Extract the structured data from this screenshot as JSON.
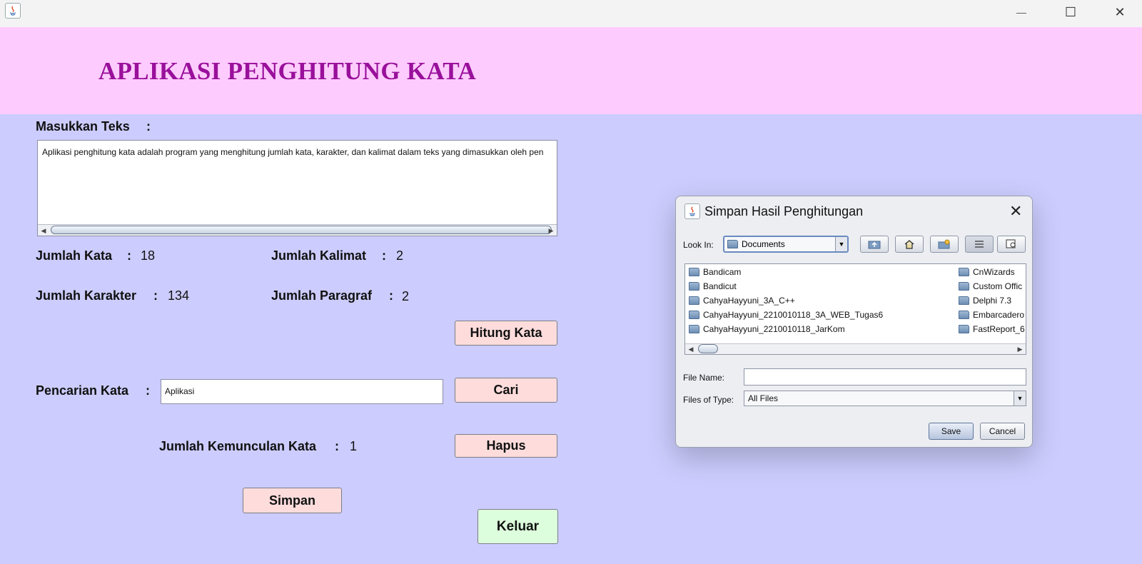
{
  "window": {
    "minimize_label": "—",
    "maximize_label": "☐",
    "close_label": "✕"
  },
  "header": {
    "title": "APLIKASI PENGHITUNG KATA"
  },
  "input": {
    "label": "Masukkan Teks",
    "colon": ":",
    "text": "Aplikasi penghitung kata adalah program yang menghitung jumlah kata, karakter, dan kalimat dalam teks yang dimasukkan oleh pen"
  },
  "stats": {
    "jumlah_kata": {
      "label": "Jumlah Kata",
      "colon": ":",
      "value": "18"
    },
    "jumlah_kalimat": {
      "label": "Jumlah Kalimat",
      "colon": ":",
      "value": "2"
    },
    "jumlah_karakter": {
      "label": "Jumlah Karakter",
      "colon": ":",
      "value": "134"
    },
    "jumlah_paragraf": {
      "label": "Jumlah Paragraf",
      "colon": ":",
      "value": "2"
    }
  },
  "buttons": {
    "hitung": "Hitung Kata",
    "cari": "Cari",
    "hapus": "Hapus",
    "simpan": "Simpan",
    "keluar": "Keluar"
  },
  "search": {
    "label": "Pencarian Kata",
    "colon": ":",
    "value": "Aplikasi"
  },
  "occurrence": {
    "label": "Jumlah Kemunculan Kata",
    "colon": ":",
    "value": "1"
  },
  "dialog": {
    "title": "Simpan Hasil Penghitungan",
    "close_label": "✕",
    "look_in_label": "Look In:",
    "look_in_value": "Documents",
    "files": [
      "Bandicam",
      "Bandicut",
      "CahyaHayyuni_3A_C++",
      "CahyaHayyuni_2210010118_3A_WEB_Tugas6",
      "CahyaHayyuni_2210010118_JarKom",
      "CnWizards",
      "Custom Offic",
      "Delphi 7.3",
      "Embarcadero",
      "FastReport_6"
    ],
    "file_name_label": "File Name:",
    "file_name_value": "",
    "file_type_label": "Files of Type:",
    "file_type_value": "All Files",
    "save_label": "Save",
    "cancel_label": "Cancel"
  }
}
